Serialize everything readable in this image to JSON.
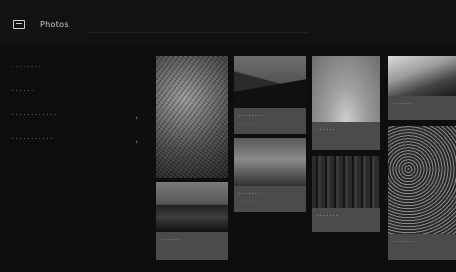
{
  "window": {
    "title": "Photos"
  },
  "sidebar": {
    "items": [
      {
        "label": "· · · · · · · ·",
        "dim": true
      },
      {
        "label": "· · · · · ·"
      },
      {
        "label": "· · · · · · · · · · · ·"
      },
      {
        "label": "· · · · · · · · · · ·"
      }
    ]
  },
  "tiles": [
    {
      "caption": "",
      "subcaption": ""
    },
    {
      "caption": "· · · · · · · ·",
      "subcaption": "· · · · ·"
    },
    {
      "caption": "· · · · · · ·",
      "subcaption": "· · · · ·"
    },
    {
      "caption": "· · · · · ·",
      "subcaption": ""
    },
    {
      "caption": "· · · · · · ·",
      "subcaption": ""
    },
    {
      "caption": "· · · · · ·",
      "subcaption": ""
    },
    {
      "caption": "· · · · · · ·",
      "subcaption": ""
    },
    {
      "caption": "· · · · · ·",
      "subcaption": ""
    },
    {
      "caption": "· · · · · ·",
      "subcaption": ""
    }
  ]
}
